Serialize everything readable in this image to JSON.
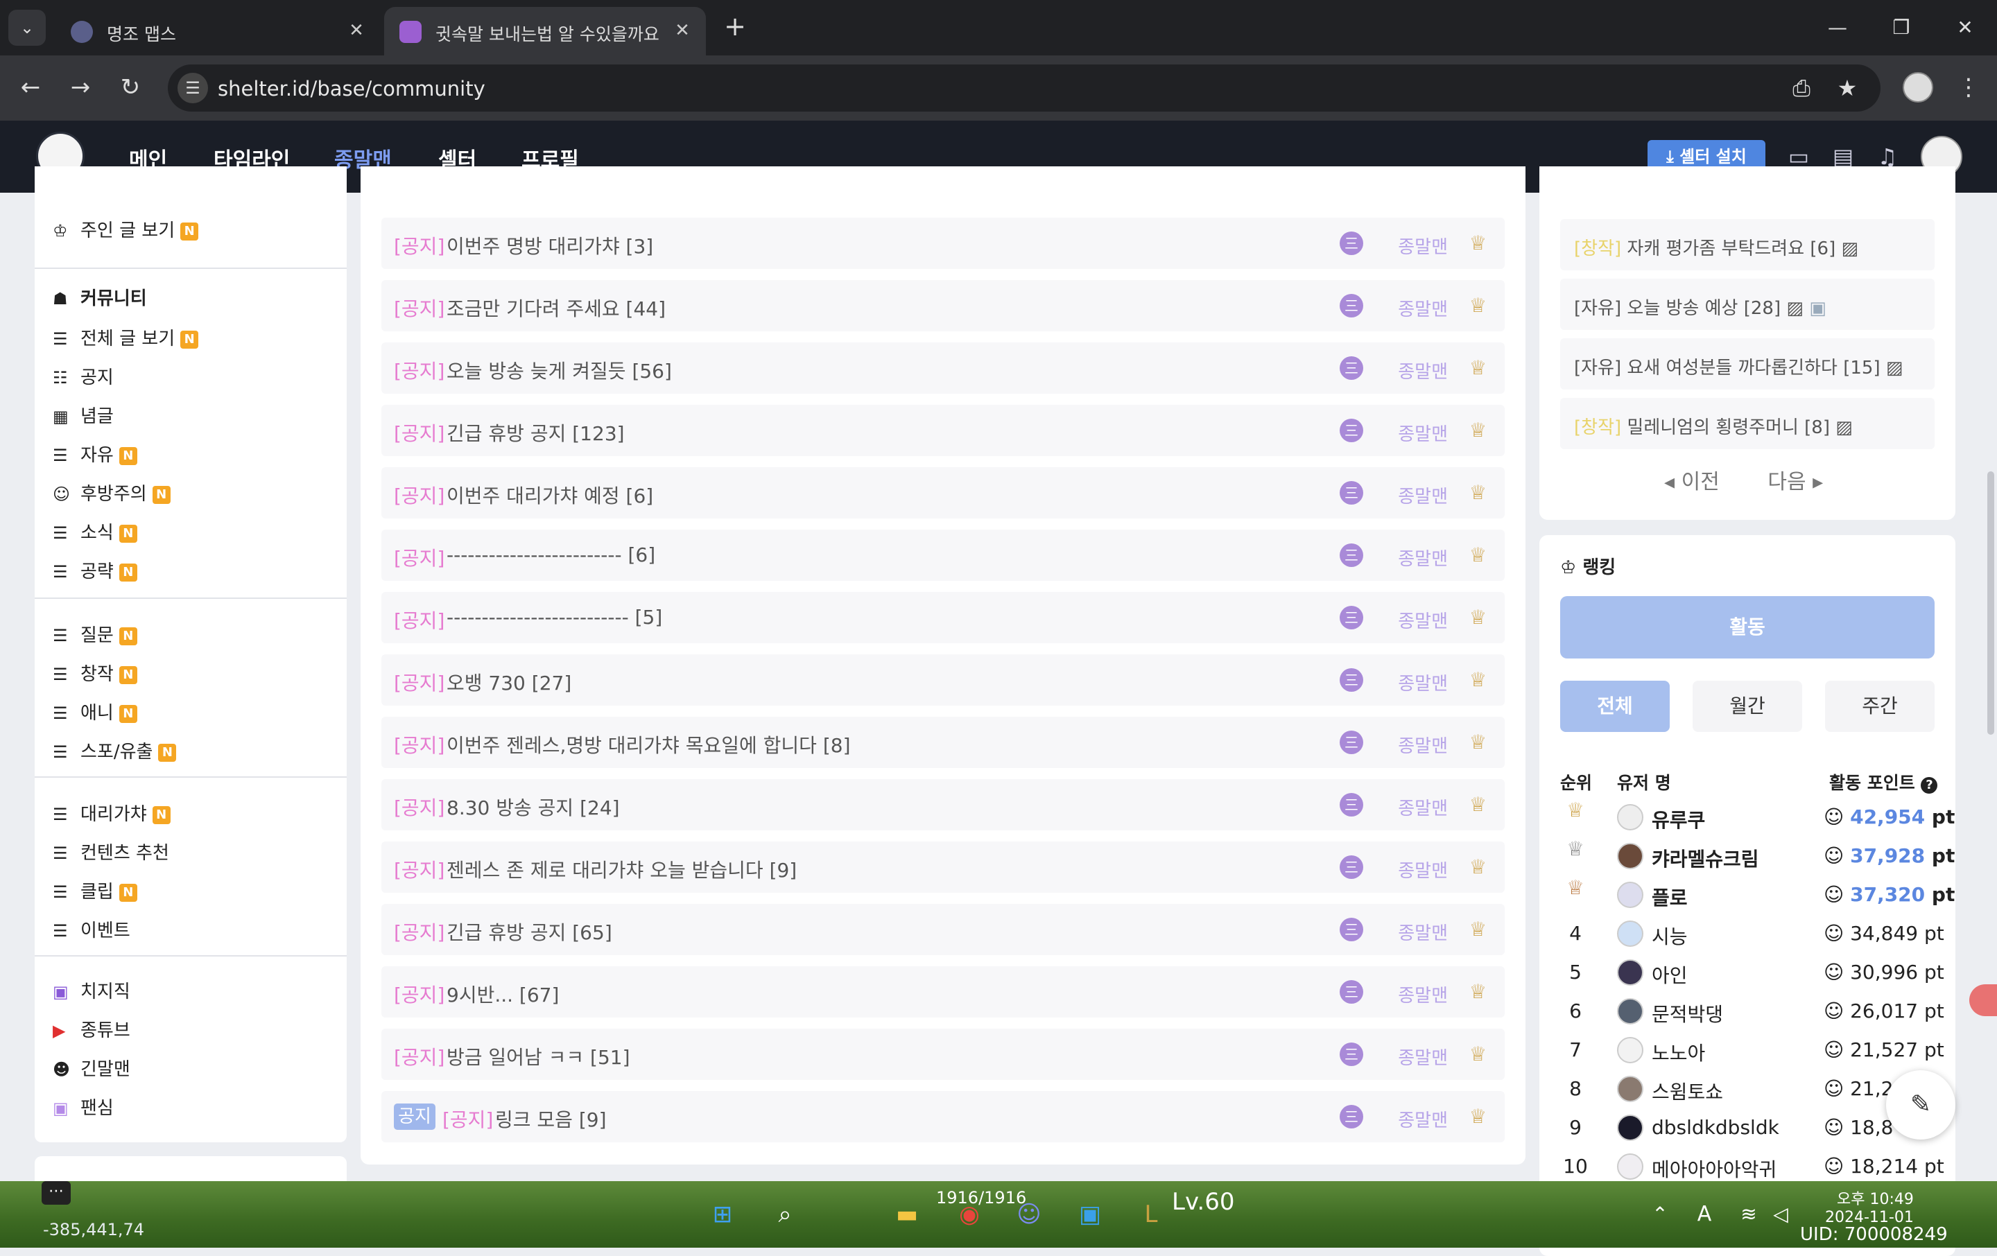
{
  "browser": {
    "tabs": [
      {
        "title": "명조 맵스",
        "close": "✕"
      },
      {
        "title": "귓속말 보내는법 알 수있을까요",
        "close": "✕"
      }
    ],
    "new_tab": "+",
    "url": "shelter.id/base/community"
  },
  "site_nav": {
    "items": [
      "메인",
      "타임라인",
      "종말맨",
      "셸터",
      "프로필"
    ],
    "active": "종말맨",
    "install_button": "셸터 설치"
  },
  "sidebar": {
    "top_items": [
      {
        "label": "주인 글 보기",
        "new": "N",
        "icon": "crown-icon"
      }
    ],
    "community_header": "커뮤니티",
    "group1": [
      {
        "label": "전체 글 보기",
        "new": "N"
      },
      {
        "label": "공지",
        "new": ""
      },
      {
        "label": "념글",
        "new": ""
      },
      {
        "label": "자유",
        "new": "N"
      },
      {
        "label": "후방주의",
        "new": "N"
      },
      {
        "label": "소식",
        "new": "N"
      },
      {
        "label": "공략",
        "new": "N"
      }
    ],
    "group2": [
      {
        "label": "질문",
        "new": "N"
      },
      {
        "label": "창작",
        "new": "N"
      },
      {
        "label": "애니",
        "new": "N"
      },
      {
        "label": "스포/유출",
        "new": "N"
      }
    ],
    "group3": [
      {
        "label": "대리가챠",
        "new": "N"
      },
      {
        "label": "컨텐츠 추천",
        "new": ""
      },
      {
        "label": "클립",
        "new": "N"
      },
      {
        "label": "이벤트",
        "new": ""
      }
    ],
    "group4": [
      {
        "label": "치지직"
      },
      {
        "label": "종튜브"
      },
      {
        "label": "긴말맨"
      },
      {
        "label": "팬심"
      }
    ]
  },
  "posts": [
    {
      "tag": "[공지]",
      "title": "이번주 명방 대리가챠 [3]",
      "author": "종말맨"
    },
    {
      "tag": "[공지]",
      "title": "조금만 기다려 주세요 [44]",
      "author": "종말맨"
    },
    {
      "tag": "[공지]",
      "title": "오늘 방송 늦게 켜질듯 [56]",
      "author": "종말맨"
    },
    {
      "tag": "[공지]",
      "title": "긴급 휴방 공지 [123]",
      "author": "종말맨"
    },
    {
      "tag": "[공지]",
      "title": "이번주 대리가챠 예정 [6]",
      "author": "종말맨"
    },
    {
      "tag": "[공지]",
      "title": "------------------------- [6]",
      "author": "종말맨"
    },
    {
      "tag": "[공지]",
      "title": "-------------------------- [5]",
      "author": "종말맨"
    },
    {
      "tag": "[공지]",
      "title": "오뱅 730 [27]",
      "author": "종말맨"
    },
    {
      "tag": "[공지]",
      "title": "이번주 젠레스,명방 대리가챠 목요일에 합니다 [8]",
      "author": "종말맨"
    },
    {
      "tag": "[공지]",
      "title": "8.30 방송 공지 [24]",
      "author": "종말맨"
    },
    {
      "tag": "[공지]",
      "title": "젠레스 존 제로 대리가챠 오늘 받습니다 [9]",
      "author": "종말맨"
    },
    {
      "tag": "[공지]",
      "title": "긴급 휴방 공지 [65]",
      "author": "종말맨"
    },
    {
      "tag": "[공지]",
      "title": "9시반... [67]",
      "author": "종말맨"
    },
    {
      "tag": "[공지]",
      "title": "방금 일어남 ㅋㅋ [51]",
      "author": "종말맨"
    },
    {
      "tag": "[공지]",
      "title": "링크 모음 [9]",
      "author": "종말맨",
      "badge": "공지"
    }
  ],
  "popular": {
    "items": [
      {
        "tag": "[창작]",
        "title": "자캐 평가좀 부탁드려요 [6]"
      },
      {
        "tag": "[자유]",
        "title": "오늘 방송 예상 [28]"
      },
      {
        "tag": "[자유]",
        "title": "요새 여성분들 까다롭긴하다 [15]"
      },
      {
        "tag": "[창작]",
        "title": "밀레니엄의 횡령주머니 [8]"
      }
    ],
    "prev": "이전",
    "next": "다음"
  },
  "ranking": {
    "title": "랭킹",
    "activity_button": "활동",
    "periods": [
      "전체",
      "월간",
      "주간"
    ],
    "selected_period": "전체",
    "columns": [
      "순위",
      "유저 명",
      "활동 포인트"
    ],
    "rows": [
      {
        "rank": "",
        "name": "유루쿠",
        "points": "42,954",
        "unit": "pt"
      },
      {
        "rank": "",
        "name": "캬라멜슈크림",
        "points": "37,928",
        "unit": "pt"
      },
      {
        "rank": "",
        "name": "플로",
        "points": "37,320",
        "unit": "pt"
      },
      {
        "rank": "4",
        "name": "시능",
        "points": "34,849",
        "unit": "pt"
      },
      {
        "rank": "5",
        "name": "아인",
        "points": "30,996",
        "unit": "pt"
      },
      {
        "rank": "6",
        "name": "문적박댕",
        "points": "26,017",
        "unit": "pt"
      },
      {
        "rank": "7",
        "name": "노노아",
        "points": "21,527",
        "unit": "pt"
      },
      {
        "rank": "8",
        "name": "스윔토쇼",
        "points": "21,2",
        "unit": ""
      },
      {
        "rank": "9",
        "name": "dbsldkdbsldk",
        "points": "18,8",
        "unit": ""
      },
      {
        "rank": "10",
        "name": "메아아아아악귀",
        "points": "18,214",
        "unit": "pt"
      }
    ]
  },
  "taskbar": {
    "coords": "-385,441,74",
    "progress": "1916/1916",
    "level": "Lv.60",
    "clock_period": "오후 10:49",
    "date": "2024-11-01",
    "uid": "UID: 700008249"
  }
}
